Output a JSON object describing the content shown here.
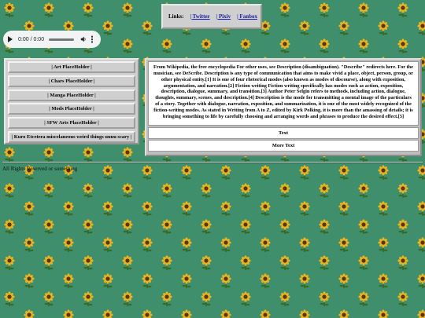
{
  "colors": {
    "background": "#3f8f6d",
    "panel": "#cfcfcf",
    "link": "#1a1aa6"
  },
  "background_icon": "sunflower-icon",
  "links": {
    "label": "Links:",
    "items": [
      "| Twitter",
      "| Pixiv",
      "| Fanbox"
    ]
  },
  "audio": {
    "time": "0:00 / 0:00",
    "icons": [
      "play-icon",
      "volume-icon",
      "more-options-icon"
    ]
  },
  "menu": {
    "items": [
      "| Art PlaceHolder |",
      "| Chars PlaceHolder |",
      "| Manga PlaceHolder |",
      "| Mods PlaceHolder |",
      "| SFW Arts PlaceHolder |",
      "| Kuro Etcetera miscelaneous weird things uuuu scary |"
    ]
  },
  "content": {
    "description": "From Wikipedia, the free encyclopedia For other uses, see Description (disambiguation). \"Describe\" redirects here. For the musician, see DeScribe. Description is any type of communication that aims to make vivid a place, object, person, group, or other physical entity.[1] It is one of four rhetorical modes (also known as modes of discourse), along with exposition, argumentation, and narration.[2] Fiction writing Fiction writing specifically has modes such as action, exposition, description, dialogue, summary, and transition.[3] Author Peter Selgin refers to methods, including action, dialogue, thoughts, summary, scenes, and description.[4] Description is the mode for transmitting a mental image of the particulars of a story. Together with dialogue, narration, exposition, and summarization, it is one of the most widely recognized of the fiction-writing modes. As stated in Writing from A to Z, edited by Kirk Polking, it is more than the amassing of details; it is bringing something to life by carefully choosing and arranging words and phrases to produce the desired effect.[5]",
    "button1": "Text",
    "button2": "More Text"
  },
  "footer": "All Rights Reserved or something"
}
